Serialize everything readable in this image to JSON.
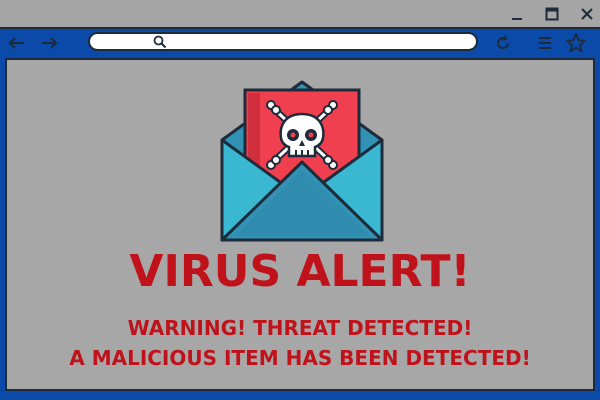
{
  "window": {
    "controls": [
      "minimize-icon",
      "maximize-icon",
      "close-icon"
    ]
  },
  "toolbar": {
    "icons": [
      "back-arrow-icon",
      "forward-arrow-icon",
      "search-icon",
      "reload-icon",
      "menu-icon",
      "star-icon"
    ],
    "address_value": "",
    "address_placeholder": ""
  },
  "alert": {
    "icon": "virus-envelope-skull-icon",
    "headline": "VIRUS ALERT!",
    "line1": "WARNING! THREAT DETECTED!",
    "line2": "A MALICIOUS ITEM HAS BEEN DETECTED!"
  },
  "colors": {
    "frame_blue": "#0b4aa8",
    "titlebar_gray": "#a5a5a5",
    "content_gray": "#a7a7a7",
    "alert_red": "#c0121a",
    "envelope_blue": "#3ab7d1",
    "envelope_dark": "#3192b5",
    "letter_red": "#f0404f"
  }
}
